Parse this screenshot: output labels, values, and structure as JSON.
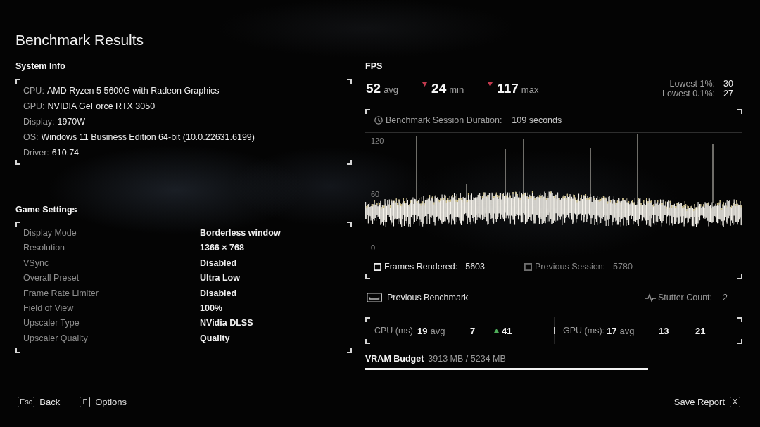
{
  "title": "Benchmark Results",
  "system_info": {
    "heading": "System Info",
    "rows": [
      {
        "label": "CPU:",
        "value": "AMD Ryzen 5 5600G with Radeon Graphics"
      },
      {
        "label": "GPU:",
        "value": "NVIDIA GeForce RTX 3050"
      },
      {
        "label": "Display:",
        "value": "1970W"
      },
      {
        "label": "OS:",
        "value": "Windows 11 Business Edition 64-bit (10.0.22631.6199)"
      },
      {
        "label": "Driver:",
        "value": "610.74"
      }
    ]
  },
  "game_settings": {
    "heading": "Game Settings",
    "rows": [
      {
        "label": "Display Mode",
        "value": "Borderless window"
      },
      {
        "label": "Resolution",
        "value": "1366 × 768"
      },
      {
        "label": "VSync",
        "value": "Disabled"
      },
      {
        "label": "Overall Preset",
        "value": "Ultra Low"
      },
      {
        "label": "Frame Rate Limiter",
        "value": "Disabled"
      },
      {
        "label": "Field of View",
        "value": "100%"
      },
      {
        "label": "Upscaler Type",
        "value": "NVidia DLSS"
      },
      {
        "label": "Upscaler Quality",
        "value": "Quality"
      }
    ]
  },
  "fps": {
    "heading": "FPS",
    "stats": [
      {
        "value": "52",
        "unit": "avg",
        "down_marker": false
      },
      {
        "value": "24",
        "unit": "min",
        "down_marker": true
      },
      {
        "value": "117",
        "unit": "max",
        "down_marker": true
      }
    ],
    "lows": [
      {
        "label": "Lowest 1%:",
        "value": "30"
      },
      {
        "label": "Lowest 0.1%:",
        "value": "27"
      }
    ]
  },
  "session_graph": {
    "duration_label": "Benchmark Session Duration:",
    "duration": "109 seconds",
    "axis_labels": [
      "120",
      "60",
      "0"
    ],
    "legend": [
      {
        "label": "Frames Rendered:",
        "value": "5603",
        "enabled": true
      },
      {
        "label": "Previous Session:",
        "value": "5780",
        "enabled": false
      }
    ]
  },
  "previous_benchmark": {
    "label": "Previous Benchmark"
  },
  "stutter": {
    "label": "Stutter Count:",
    "value": "2"
  },
  "frame_times": [
    {
      "label": "CPU (ms):",
      "readings": [
        {
          "value": "19",
          "unit": "avg",
          "up_marker": false
        },
        {
          "value": "7",
          "up_marker": false
        },
        {
          "value": "41",
          "up_marker": true
        }
      ]
    },
    {
      "label": "GPU (ms):",
      "readings": [
        {
          "value": "17",
          "unit": "avg",
          "up_marker": false
        },
        {
          "value": "13",
          "up_marker": false
        },
        {
          "value": "21",
          "up_marker": false
        }
      ]
    }
  ],
  "vram": {
    "label": "VRAM Budget",
    "reading": "3913 MB / 5234 MB",
    "level": 0.75
  },
  "footer": {
    "left": [
      {
        "key": "Esc",
        "label": "Back"
      },
      {
        "key": "F",
        "label": "Options"
      }
    ],
    "right": [
      {
        "label": "Save Report",
        "key": "X"
      }
    ]
  }
}
